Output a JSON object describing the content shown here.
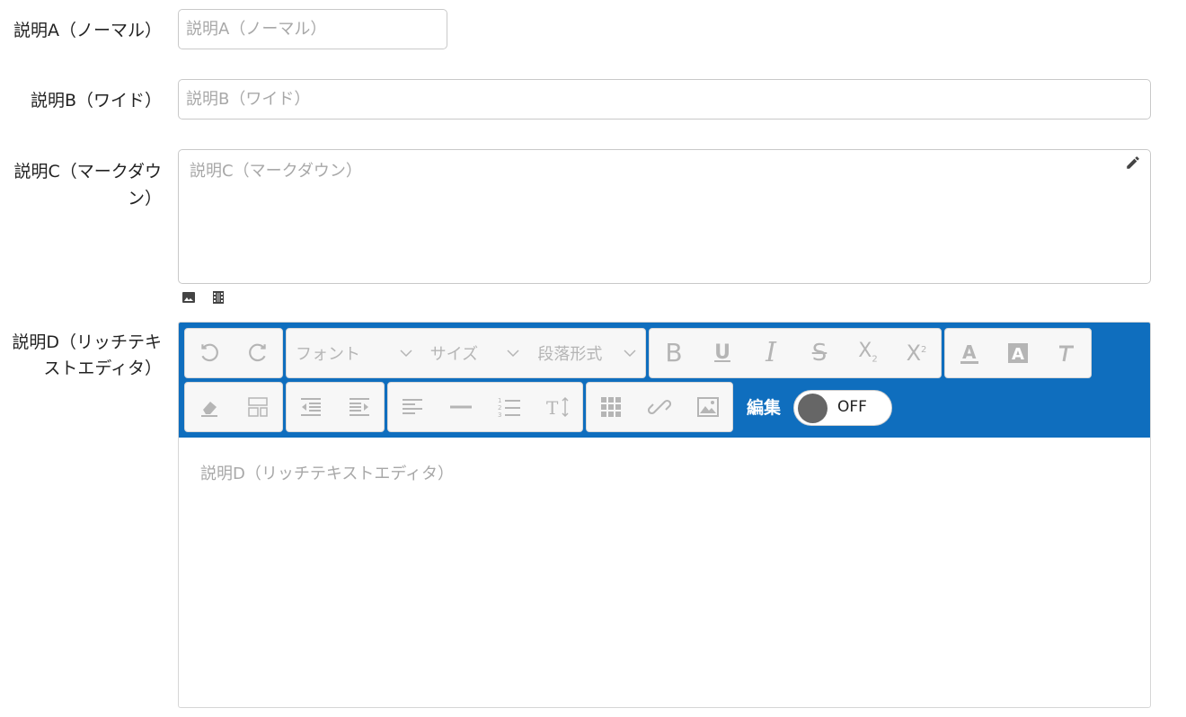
{
  "fields": {
    "a": {
      "label": "説明A（ノーマル）",
      "placeholder": "説明A（ノーマル）",
      "value": ""
    },
    "b": {
      "label": "説明B（ワイド）",
      "placeholder": "説明B（ワイド）",
      "value": ""
    },
    "c": {
      "label": "説明C（マークダウン）",
      "placeholder": "説明C（マークダウン）",
      "value": "",
      "icons": [
        "pencil-icon",
        "image-icon",
        "video-icon"
      ]
    },
    "d": {
      "label": "説明D（リッチテキストエディタ）",
      "placeholder": "説明D（リッチテキストエディタ）"
    }
  },
  "toolbar": {
    "font_label": "フォント",
    "size_label": "サイズ",
    "paragraph_label": "段落形式",
    "edit_label": "編集",
    "toggle_state": "OFF",
    "toolbar_color": "#0f6ebe",
    "icons_row1": [
      "undo-icon",
      "redo-icon",
      "bold-icon",
      "underline-icon",
      "italic-icon",
      "strikethrough-icon",
      "subscript-icon",
      "superscript-icon",
      "font-color-icon",
      "background-color-icon",
      "clear-format-icon"
    ],
    "icons_row2": [
      "eraser-icon",
      "template-icon",
      "outdent-icon",
      "indent-icon",
      "align-icon",
      "horizontal-rule-icon",
      "ordered-list-icon",
      "line-height-icon",
      "table-icon",
      "link-icon",
      "image-icon"
    ]
  }
}
